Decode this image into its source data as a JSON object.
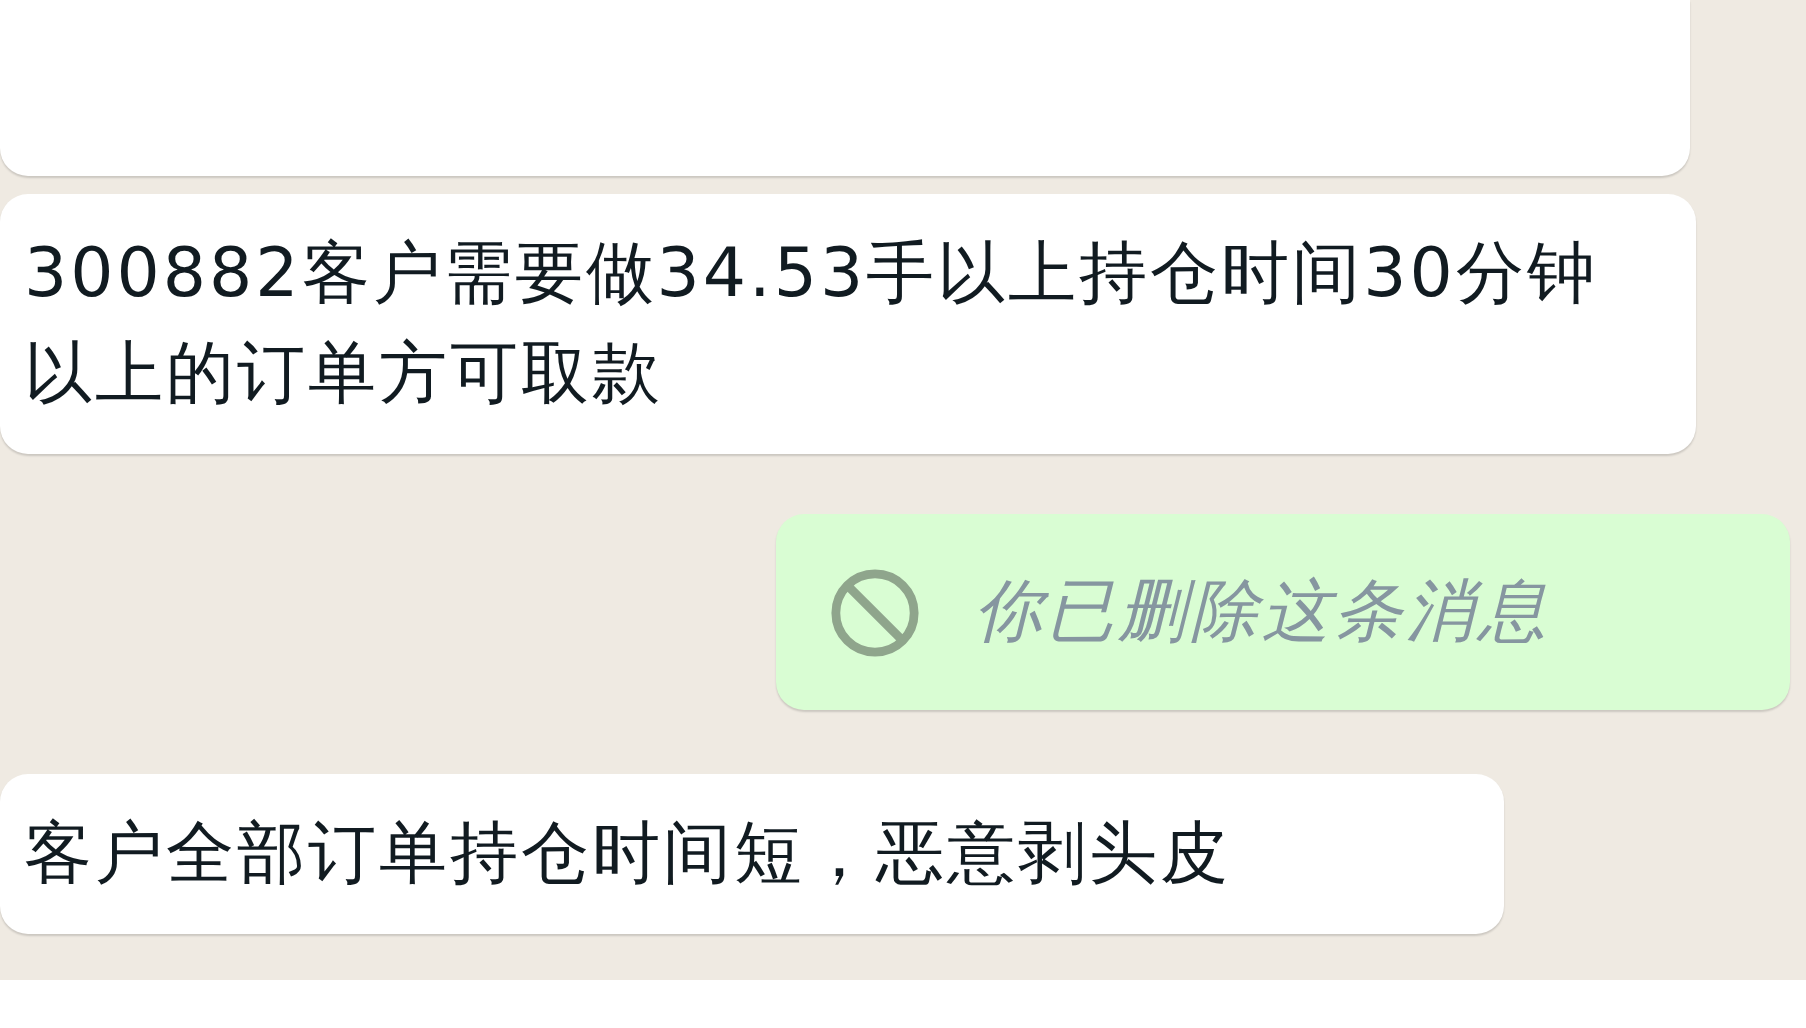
{
  "messages": [
    {
      "kind": "partial",
      "outgoing": false
    },
    {
      "kind": "text",
      "outgoing": false,
      "text": "300882客户需要做34.53手以上持仓时间30分钟以上的订单方可取款"
    },
    {
      "kind": "deleted",
      "outgoing": true,
      "text": "你已删除这条消息"
    },
    {
      "kind": "text",
      "outgoing": false,
      "text": "客户全部订单持仓时间短，恶意剥头皮"
    }
  ]
}
